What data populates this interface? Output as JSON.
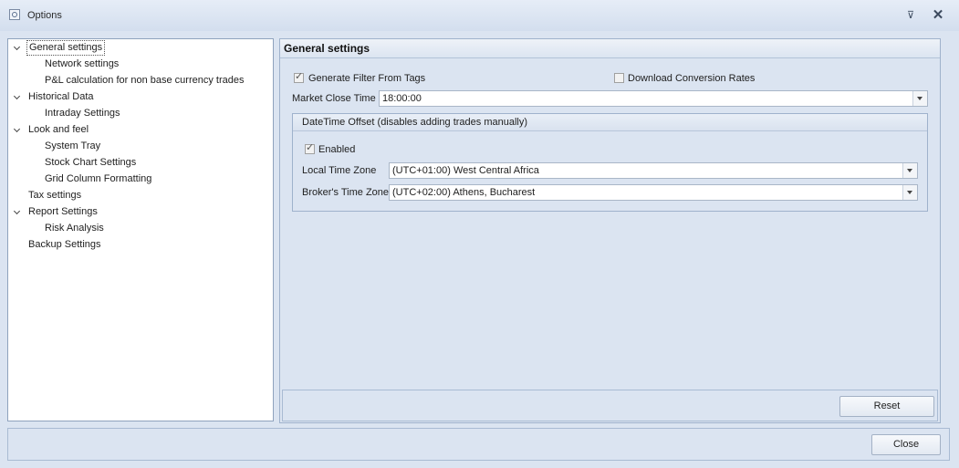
{
  "window": {
    "title": "Options",
    "pin_glyph": "⊽",
    "close_glyph": "✕"
  },
  "tree": {
    "items": [
      {
        "label": "General settings",
        "expanded": true,
        "selected": true
      },
      {
        "label": "Network settings"
      },
      {
        "label": "P&L calculation for non base currency trades"
      },
      {
        "label": "Historical Data",
        "expanded": true
      },
      {
        "label": "Intraday Settings"
      },
      {
        "label": "Look and feel",
        "expanded": true
      },
      {
        "label": "System Tray"
      },
      {
        "label": "Stock Chart Settings"
      },
      {
        "label": "Grid Column Formatting"
      },
      {
        "label": "Tax settings"
      },
      {
        "label": "Report Settings",
        "expanded": true
      },
      {
        "label": "Risk Analysis"
      },
      {
        "label": "Backup Settings"
      }
    ]
  },
  "panel": {
    "title": "General settings",
    "generate_filter": {
      "label": "Generate Filter From Tags",
      "checked": true
    },
    "download_rates": {
      "label": "Download Conversion Rates",
      "checked": false
    },
    "market_close": {
      "label": "Market Close Time",
      "value": "18:00:00"
    },
    "datetime_offset": {
      "title": "DateTime Offset (disables adding trades manually)",
      "enabled": {
        "label": "Enabled",
        "checked": true
      },
      "local_tz": {
        "label": "Local Time Zone",
        "value": "(UTC+01:00) West Central Africa"
      },
      "broker_tz": {
        "label": "Broker's Time Zone",
        "value": "(UTC+02:00) Athens, Bucharest"
      }
    },
    "reset_label": "Reset"
  },
  "footer": {
    "close_label": "Close"
  },
  "check_glyph": "✓"
}
